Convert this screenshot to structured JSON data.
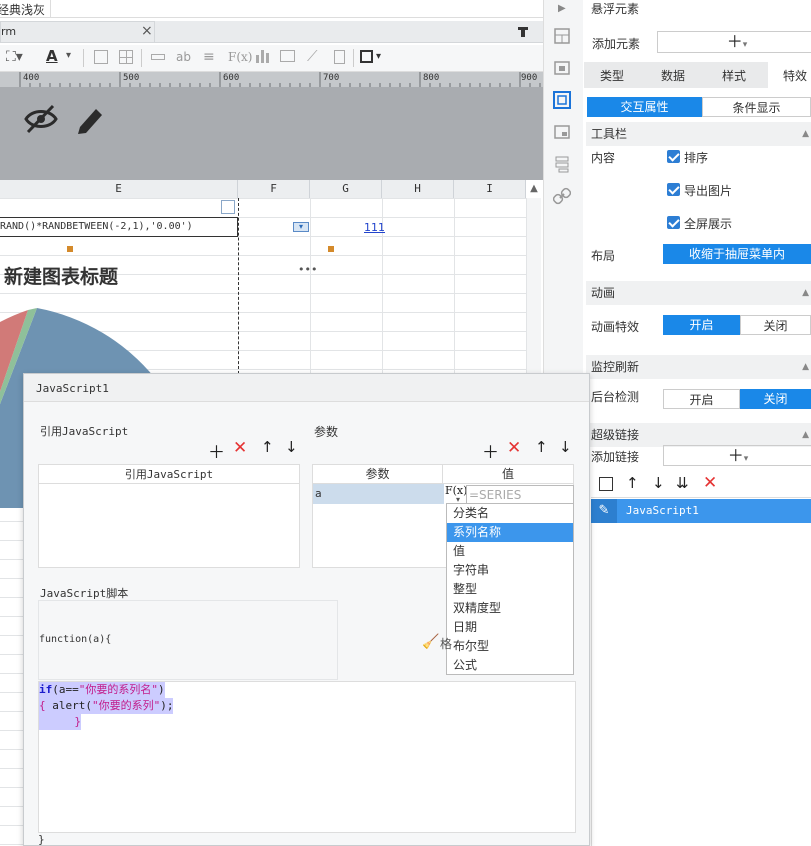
{
  "top": {
    "title_fragment": "经典浅灰",
    "tab_fragment": "rm"
  },
  "ruler": {
    "labels": [
      "400",
      "500",
      "600",
      "700",
      "800",
      "900"
    ]
  },
  "sheet": {
    "columns": [
      "E",
      "F",
      "G",
      "H",
      "I"
    ],
    "formula": "RAND()*RANDBETWEEN(-2,1),'0.00')",
    "cell_g": "111",
    "chart_title": "新建图表标题",
    "more": "•••"
  },
  "right": {
    "header": "悬浮元素",
    "add_label": "添加元素",
    "tabs": [
      "类型",
      "数据",
      "样式",
      "特效"
    ],
    "subtabs": [
      "交互属性",
      "条件显示"
    ],
    "toolbar_section": "工具栏",
    "content_label": "内容",
    "checks": [
      "排序",
      "导出图片",
      "全屏展示"
    ],
    "layout_label": "布局",
    "layout_value": "收缩于抽屉菜单内",
    "anim_section": "动画",
    "anim_label": "动画特效",
    "anim_on": "开启",
    "anim_off": "关闭",
    "monitor_section": "监控刷新",
    "bg_label": "后台检测",
    "bg_on": "开启",
    "bg_off": "关闭",
    "link_section": "超级链接",
    "add_link_label": "添加链接",
    "link_item": "JavaScript1"
  },
  "dialog": {
    "title": "JavaScript1",
    "ref_section": "引用JavaScript",
    "ref_header": "引用JavaScript",
    "params_section": "参数",
    "params_header_name": "参数",
    "params_header_value": "值",
    "param_row_name": "a",
    "value_placeholder": "=SERIES",
    "fx_label": "F(x)",
    "dropdown_items": [
      "分类名",
      "系列名称",
      "值",
      "字符串",
      "整型",
      "双精度型",
      "日期",
      "布尔型",
      "公式"
    ],
    "selected_index": 1,
    "script_section": "JavaScript脚本",
    "function_header": "function(a){",
    "code_line1_kw": "if",
    "code_line1_rest": "(a==",
    "code_line1_str": "\"你要的系列名\"",
    "code_line1_end": ")",
    "code_line2_brace": "{",
    "code_line2_fn": " alert(",
    "code_line2_str": "\"你要的系列\"",
    "code_line2_end": ");",
    "code_line3": "}",
    "closing_brace": "}",
    "side_fragment": "格"
  }
}
